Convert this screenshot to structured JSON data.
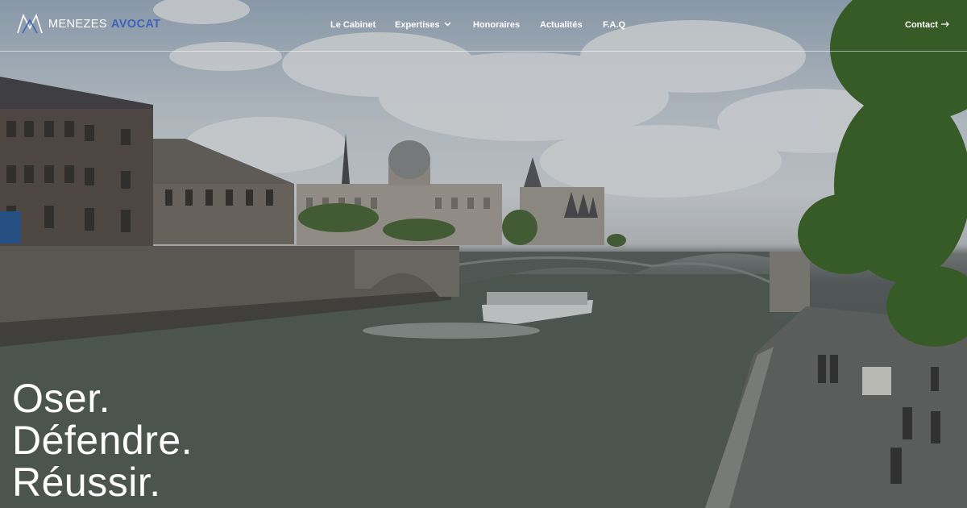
{
  "header": {
    "logo": {
      "name": "MENEZES",
      "sub": "AVOCAT",
      "icon": "monogram-logo-icon"
    },
    "nav": [
      {
        "label": "Le Cabinet"
      },
      {
        "label": "Expertises",
        "icon": "chevron-down-icon"
      },
      {
        "label": "Honoraires"
      },
      {
        "label": "Actualités"
      },
      {
        "label": "F.A.Q"
      }
    ],
    "contact": {
      "label": "Contact",
      "icon": "arrow-right-icon"
    }
  },
  "hero": {
    "lines": [
      "Oser.",
      "Défendre.",
      "Réussir."
    ]
  },
  "colors": {
    "accent": "#3f63b8",
    "text": "#ffffff"
  }
}
